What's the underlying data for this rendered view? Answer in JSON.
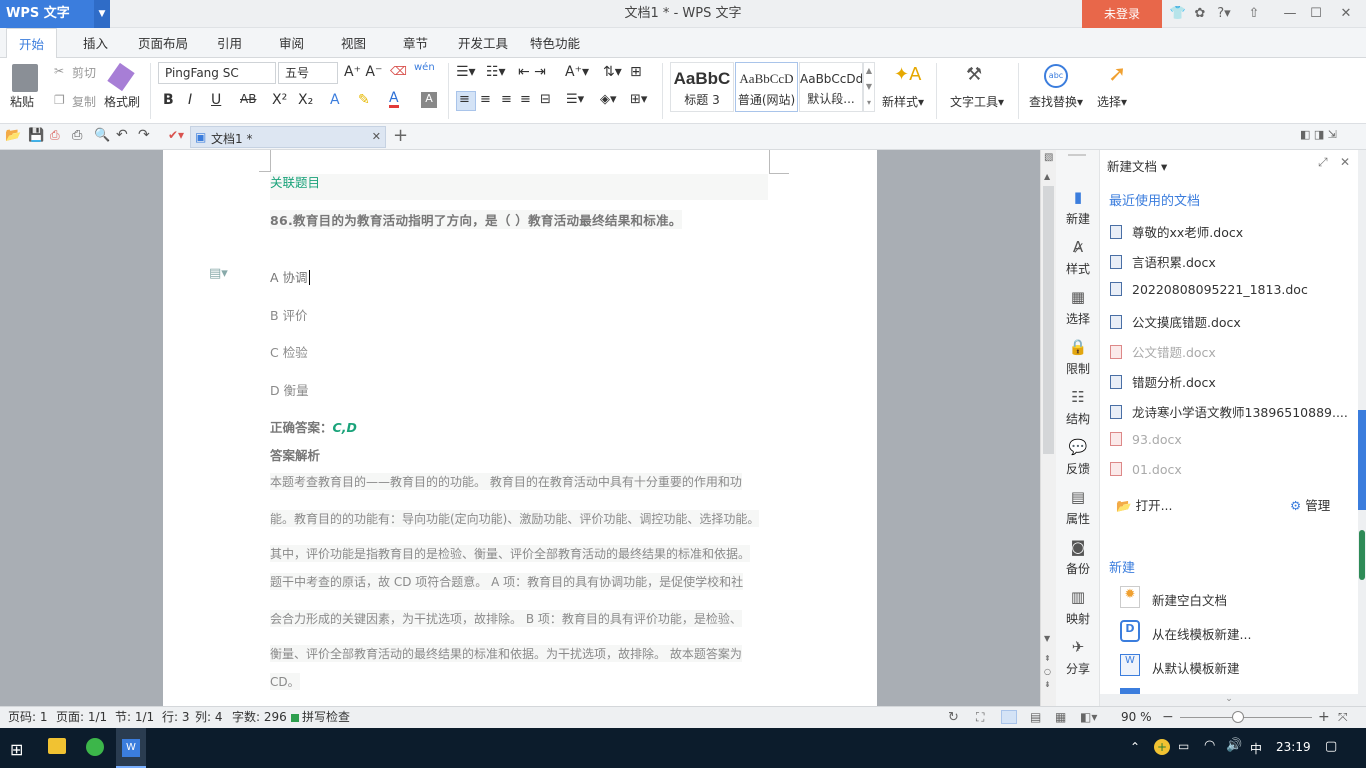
{
  "app": {
    "logo": "WPS 文字",
    "title": "文档1 * - WPS 文字",
    "login": "未登录"
  },
  "tabs": [
    "开始",
    "插入",
    "页面布局",
    "引用",
    "审阅",
    "视图",
    "章节",
    "开发工具",
    "特色功能"
  ],
  "ribbon": {
    "paste": "粘贴",
    "cut": "剪切",
    "copy": "复制",
    "format_painter": "格式刷",
    "font_name": "PingFang SC",
    "font_size": "五号",
    "styles": [
      {
        "preview": "AaBbC",
        "name": "标题 3"
      },
      {
        "preview": "AaBbCcD",
        "name": "普通(网站)"
      },
      {
        "preview": "AaBbCcDd",
        "name": "默认段..."
      }
    ],
    "new_style": "新样式",
    "text_tools": "文字工具",
    "find_replace": "查找替换",
    "select": "选择"
  },
  "doc_tab": {
    "name": "文档1 *"
  },
  "document": {
    "related_title": "关联题目",
    "question": "86.教育目的为教育活动指明了方向，是（   ）教育活动最终结果和标准。",
    "options": [
      "A 协调",
      "B 评价",
      "C 检验",
      "D 衡量"
    ],
    "answer_label": "正确答案：",
    "answer_value": "C,D",
    "analysis_title": "答案解析",
    "analysis_lines": [
      "本题考查教育目的——教育目的的功能。 教育目的在教育活动中具有十分重要的作用和功",
      "能。教育目的的功能有：导向功能(定向功能)、激励功能、评价功能、调控功能、选择功能。",
      "其中，评价功能是指教育目的是检验、衡量、评价全部教育活动的最终结果的标准和依据。",
      "题干中考查的原话，故 CD 项符合题意。 A 项：教育目的具有协调功能，是促使学校和社",
      "会合力形成的关键因素，为干扰选项，故排除。 B 项：教育目的具有评价功能，是检验、",
      "衡量、评价全部教育活动的最终结果的标准和依据。为干扰选项，故排除。 故本题答案为",
      "CD。"
    ]
  },
  "sidebar": [
    "新建",
    "样式",
    "选择",
    "限制",
    "结构",
    "反馈",
    "属性",
    "备份",
    "映射",
    "分享"
  ],
  "panel": {
    "title": "新建文档",
    "recent_title": "最近使用的文档",
    "recent": [
      {
        "name": "尊敬的xx老师.docx",
        "dim": false
      },
      {
        "name": "言语积累.docx",
        "dim": false
      },
      {
        "name": "20220808095221_1813.doc",
        "dim": false
      },
      {
        "name": "公文摸底错题.docx",
        "dim": false
      },
      {
        "name": "公文错题.docx",
        "dim": true
      },
      {
        "name": "错题分析.docx",
        "dim": false
      },
      {
        "name": "龙诗寒小学语文教师13896510889....",
        "dim": false
      },
      {
        "name": "93.docx",
        "dim": true
      },
      {
        "name": "01.docx",
        "dim": true
      }
    ],
    "open": "打开...",
    "manage": "管理",
    "new_title": "新建",
    "new_items": [
      "新建空白文档",
      "从在线模板新建...",
      "从默认模板新建"
    ]
  },
  "status": {
    "page_code": "页码: 1",
    "page": "页面: 1/1",
    "section": "节: 1/1",
    "row": "行: 3",
    "col": "列: 4",
    "words": "字数: 296",
    "spell": "拼写检查",
    "zoom": "90 %"
  },
  "taskbar": {
    "ime": "中",
    "time": "23:19"
  }
}
